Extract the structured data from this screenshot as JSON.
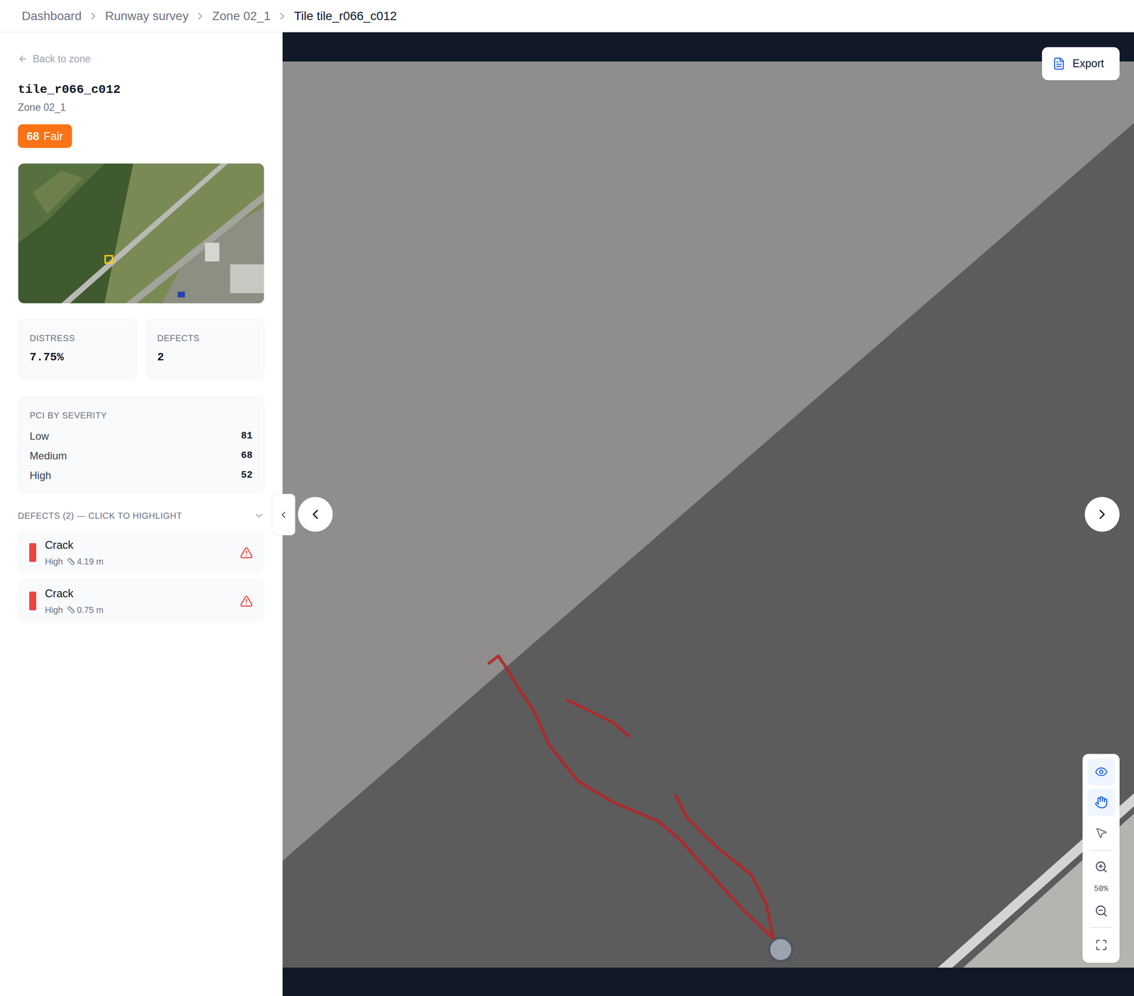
{
  "breadcrumb": [
    {
      "label": "Dashboard",
      "current": false
    },
    {
      "label": "Runway survey",
      "current": false
    },
    {
      "label": "Zone 02_1",
      "current": false
    },
    {
      "label": "Tile tile_r066_c012",
      "current": true
    }
  ],
  "sidebar": {
    "back_link": "Back to zone",
    "title": "tile_r066_c012",
    "subtitle": "Zone 02_1",
    "badge": {
      "score": "68",
      "label": "Fair",
      "color": "#f97316"
    },
    "stats": [
      {
        "label": "DISTRESS",
        "value": "7.75%"
      },
      {
        "label": "DEFECTS",
        "value": "2"
      }
    ],
    "pci": {
      "heading": "PCI BY SEVERITY",
      "rows": [
        {
          "label": "Low",
          "value": "81"
        },
        {
          "label": "Medium",
          "value": "68"
        },
        {
          "label": "High",
          "value": "52"
        }
      ]
    },
    "defects": {
      "heading": "DEFECTS (2) — CLICK TO HIGHLIGHT",
      "expanded": true,
      "items": [
        {
          "type": "Crack",
          "severity": "High",
          "length": "4.19 m",
          "color": "#ef4444"
        },
        {
          "type": "Crack",
          "severity": "High",
          "length": "0.75 m",
          "color": "#ef4444"
        }
      ]
    }
  },
  "viewer": {
    "export_button": "Export",
    "zoom": "50%",
    "tools": [
      {
        "kind": "view",
        "selected": true
      },
      {
        "kind": "pan",
        "selected": true
      },
      {
        "kind": "select",
        "selected": false
      }
    ]
  }
}
